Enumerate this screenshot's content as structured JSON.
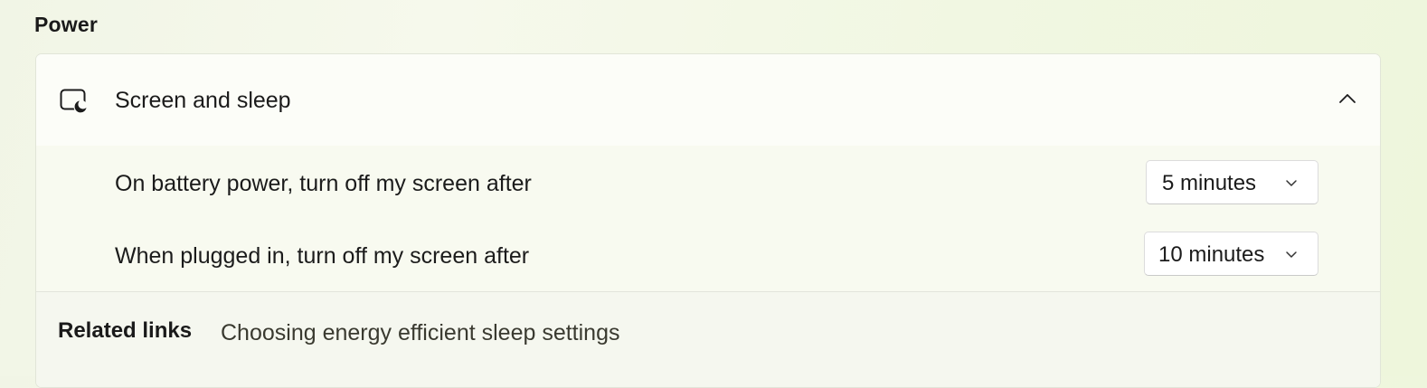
{
  "section": {
    "title": "Power"
  },
  "screen_sleep": {
    "header_label": "Screen and sleep",
    "header_icon": "screen-sleep-icon",
    "collapse_icon": "chevron-up-icon",
    "expanded": true,
    "settings": [
      {
        "label": "On battery power, turn off my screen after",
        "value": "5 minutes"
      },
      {
        "label": "When plugged in, turn off my screen after",
        "value": "10 minutes"
      }
    ]
  },
  "related_links": {
    "title": "Related links",
    "links": [
      "Choosing energy efficient sleep settings"
    ]
  },
  "colors": {
    "background": "#f1f7e2",
    "card": "#fbfcf6",
    "text": "#1b1b1b",
    "link_text": "#3a3a30"
  }
}
